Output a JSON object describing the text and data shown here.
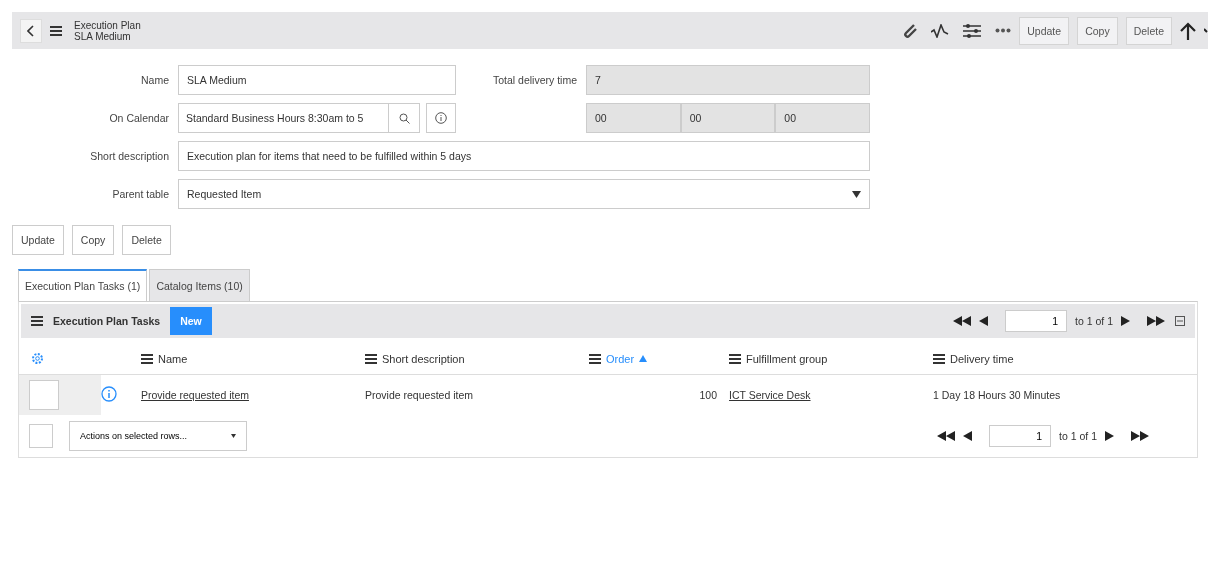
{
  "header": {
    "title": "Execution Plan",
    "subtitle": "SLA Medium",
    "actions": [
      "Update",
      "Copy",
      "Delete"
    ]
  },
  "form": {
    "name": {
      "label": "Name",
      "value": "SLA Medium"
    },
    "calendar": {
      "label": "On Calendar",
      "value": "Standard Business Hours 8:30am to 5"
    },
    "short_description": {
      "label": "Short description",
      "value": "Execution plan for items that need to be fulfilled within 5 days"
    },
    "parent_table": {
      "label": "Parent table",
      "value": "Requested Item"
    },
    "total_delivery_time": {
      "label": "Total delivery time",
      "days": "7",
      "hours": "00",
      "minutes": "00",
      "seconds": "00"
    }
  },
  "buttons": [
    "Update",
    "Copy",
    "Delete"
  ],
  "tabs": [
    {
      "label": "Execution Plan Tasks (1)",
      "selected": true
    },
    {
      "label": "Catalog Items (10)",
      "selected": false
    }
  ],
  "list": {
    "title": "Execution Plan Tasks",
    "new_label": "New",
    "pager": {
      "page": "1",
      "range": "to 1 of 1"
    },
    "columns": [
      {
        "label": "Name",
        "sorted": false
      },
      {
        "label": "Short description",
        "sorted": false
      },
      {
        "label": "Order",
        "sorted": true
      },
      {
        "label": "Fulfillment group",
        "sorted": false
      },
      {
        "label": "Delivery time",
        "sorted": false
      }
    ],
    "rows": [
      {
        "checked": false,
        "cells": [
          {
            "kind": "link",
            "text": "Provide requested item"
          },
          {
            "kind": "text",
            "text": "Provide requested item"
          },
          {
            "kind": "number",
            "text": "100"
          },
          {
            "kind": "link",
            "text": "ICT Service Desk"
          },
          {
            "kind": "text",
            "text": "1 Day 18 Hours 30 Minutes"
          }
        ]
      }
    ],
    "footer": {
      "checked": false,
      "actions": "Actions on selected rows...",
      "pager": {
        "page": "1",
        "range": "to 1 of 1"
      }
    }
  }
}
